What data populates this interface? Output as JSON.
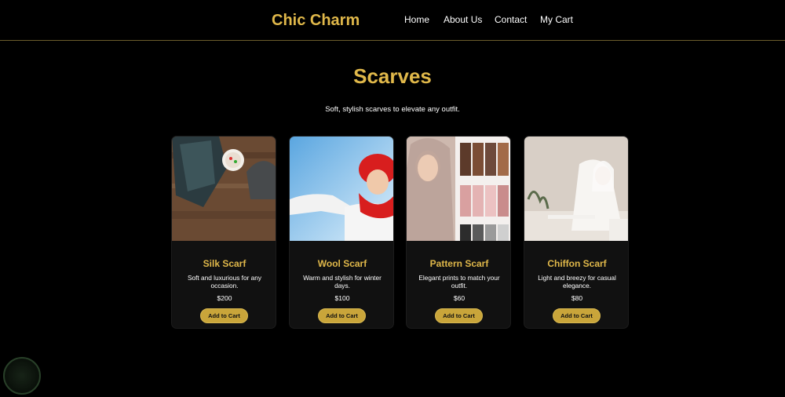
{
  "header": {
    "brand": "Chic Charm",
    "nav": [
      {
        "label": "Home"
      },
      {
        "label": "About Us"
      },
      {
        "label": "Contact"
      },
      {
        "label": "My Cart"
      }
    ]
  },
  "main": {
    "title": "Scarves",
    "subtitle": "Soft, stylish scarves to elevate any outfit."
  },
  "products": [
    {
      "name": "Silk Scarf",
      "description": "Soft and luxurious for any occasion.",
      "price": "$200",
      "button": "Add to Cart"
    },
    {
      "name": "Wool Scarf",
      "description": "Warm and stylish for winter days.",
      "price": "$100",
      "button": "Add to Cart"
    },
    {
      "name": "Pattern Scarf",
      "description": "Elegant prints to match your outfit.",
      "price": "$60",
      "button": "Add to Cart"
    },
    {
      "name": "Chiffon Scarf",
      "description": "Light and breezy for casual elegance.",
      "price": "$80",
      "button": "Add to Cart"
    }
  ],
  "colors": {
    "accent": "#e0b84a",
    "button": "#c9a53a",
    "card": "#111111",
    "background": "#000000"
  }
}
